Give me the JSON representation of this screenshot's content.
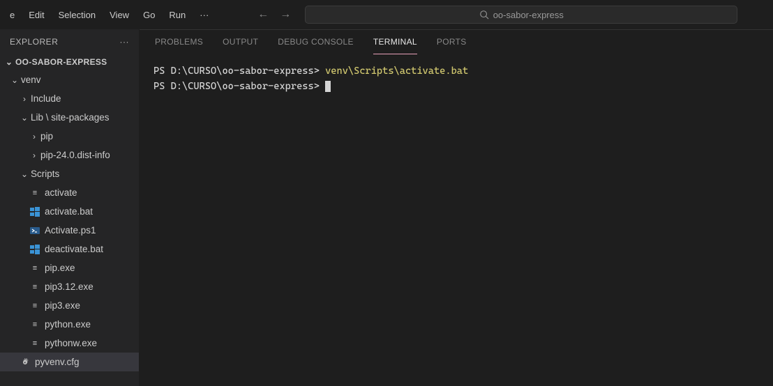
{
  "menubar": {
    "items": [
      "e",
      "Edit",
      "Selection",
      "View",
      "Go",
      "Run"
    ],
    "ellipsis": "···"
  },
  "search": {
    "placeholder": "oo-sabor-express"
  },
  "explorer": {
    "title": "EXPLORER",
    "actions": "···",
    "project": "OO-SABOR-EXPRESS"
  },
  "tree": {
    "venv": "venv",
    "include": "Include",
    "lib": "Lib \\ site-packages",
    "pip": "pip",
    "pipdist": "pip-24.0.dist-info",
    "scripts": "Scripts",
    "activate": "activate",
    "activate_bat": "activate.bat",
    "activate_ps1": "Activate.ps1",
    "deactivate_bat": "deactivate.bat",
    "pip_exe": "pip.exe",
    "pip312_exe": "pip3.12.exe",
    "pip3_exe": "pip3.exe",
    "python_exe": "python.exe",
    "pythonw_exe": "pythonw.exe",
    "pyvenv_cfg": "pyvenv.cfg"
  },
  "panel": {
    "tabs": {
      "problems": "PROBLEMS",
      "output": "OUTPUT",
      "debug": "DEBUG CONSOLE",
      "terminal": "TERMINAL",
      "ports": "PORTS"
    }
  },
  "terminal": {
    "line1_prompt": "PS D:\\CURSO\\oo-sabor-express> ",
    "line1_cmd": "venv\\Scripts\\activate.bat",
    "line2_prompt": "PS D:\\CURSO\\oo-sabor-express> "
  }
}
